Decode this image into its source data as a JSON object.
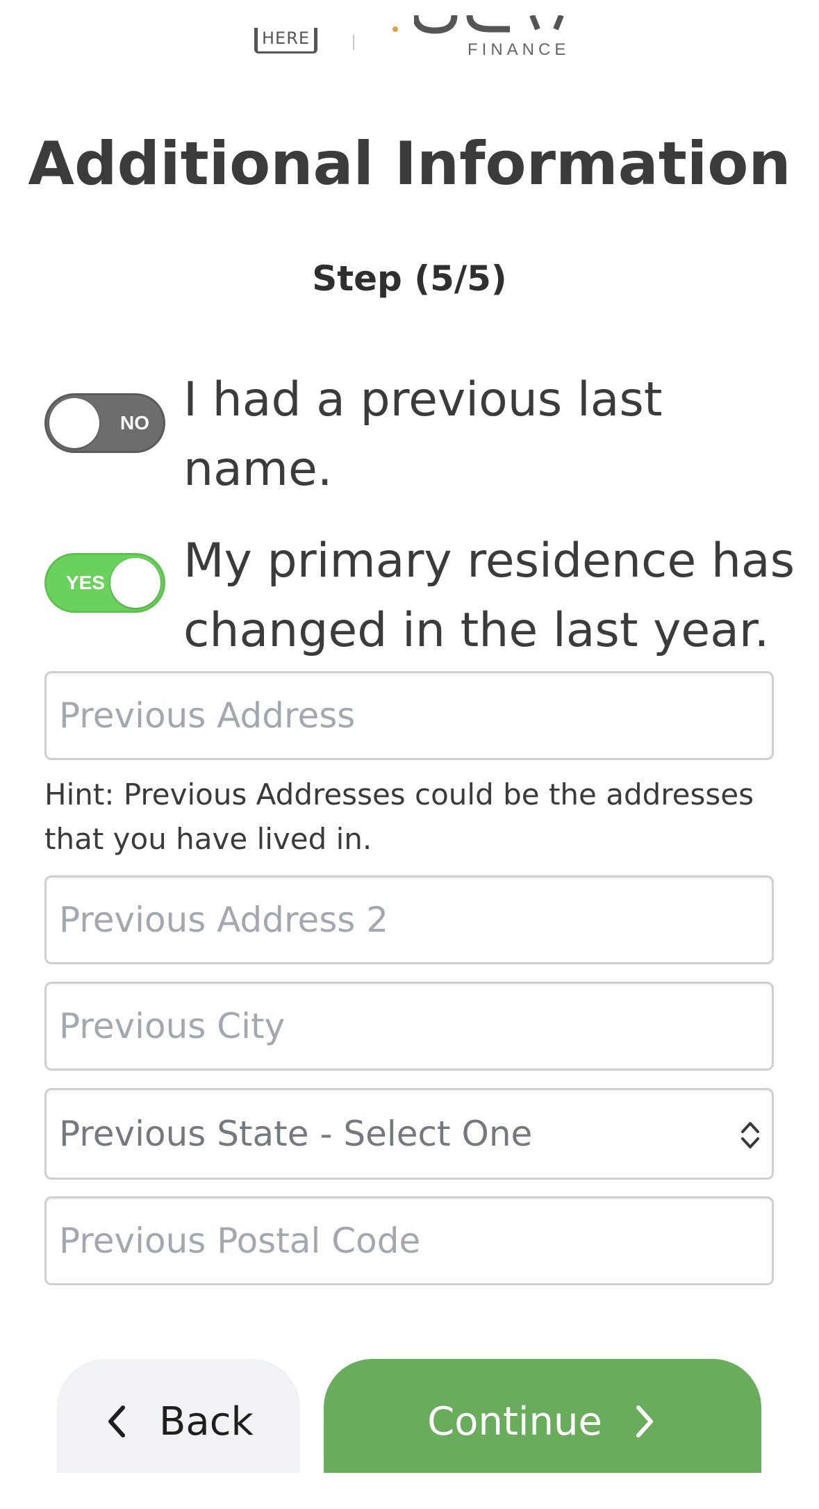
{
  "logo": {
    "partner_word": "HERE",
    "brand_sub": "FINANCE",
    "accent_color": "#d7a640"
  },
  "header": {
    "title": "Additional Information",
    "step": "Step (5/5)"
  },
  "toggles": [
    {
      "state_text": "NO",
      "on": false,
      "label": "I had a previous last name."
    },
    {
      "state_text": "YES",
      "on": true,
      "label": "My primary residence has changed in the last year."
    }
  ],
  "form": {
    "previous_address": {
      "placeholder": "Previous Address",
      "value": ""
    },
    "hint": "Hint: Previous Addresses could be the addresses that you have lived in.",
    "previous_address_2": {
      "placeholder": "Previous Address 2",
      "value": ""
    },
    "previous_city": {
      "placeholder": "Previous City",
      "value": ""
    },
    "previous_state": {
      "selected": "Previous State - Select One"
    },
    "previous_postal_code": {
      "placeholder": "Previous Postal Code",
      "value": ""
    }
  },
  "buttons": {
    "back": "Back",
    "continue": "Continue"
  },
  "colors": {
    "toggle_on": "#6bd15d",
    "toggle_off": "#6d6d6d",
    "continue_bg": "#69ad5c",
    "back_bg": "#f1f2f6"
  },
  "icons": {
    "back": "chevron-left-icon",
    "continue": "chevron-right-icon",
    "select": "select-caret-icon"
  }
}
